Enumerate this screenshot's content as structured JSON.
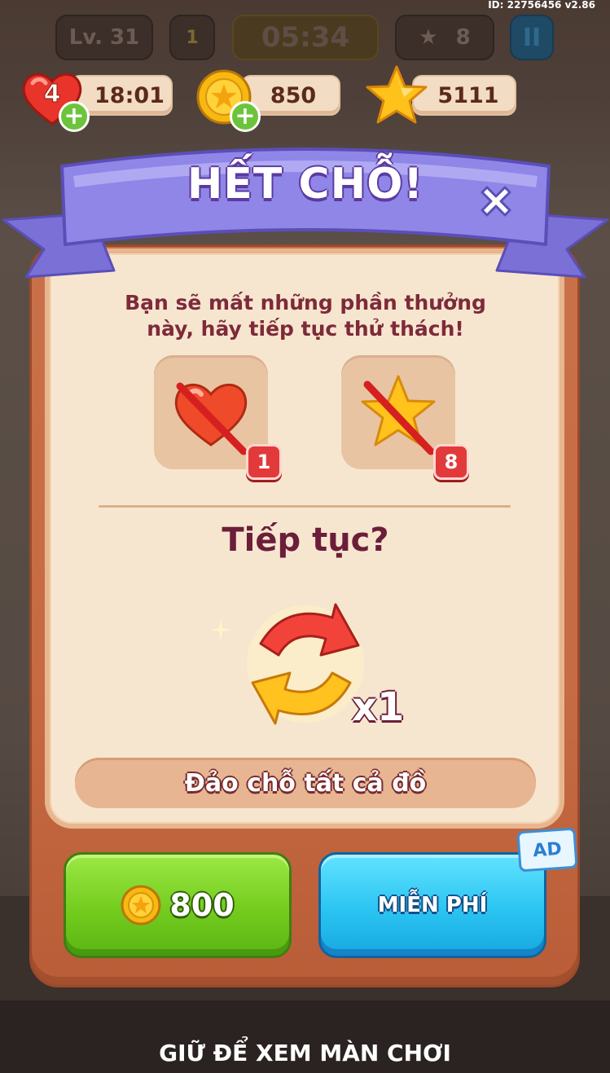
{
  "version_label": "ID: 22756456 v2.86",
  "hud": {
    "level": "Lv. 31",
    "pet_count": "1",
    "timer": "05:34",
    "stars_collected": "8",
    "pause_symbol": "II"
  },
  "resources": {
    "hearts_count": "4",
    "hearts_timer": "18:01",
    "coins": "850",
    "stars": "5111"
  },
  "popup": {
    "title": "HẾT CHỖ!",
    "message": "Bạn sẽ mất những phần thưởng này, hãy tiếp tục thử thách!",
    "rewards": [
      {
        "icon": "heart-icon",
        "count": "1"
      },
      {
        "icon": "star-icon",
        "count": "8"
      }
    ],
    "continue_prompt": "Tiếp tục?",
    "booster_multiplier": "x1",
    "booster_description": "Đảo chỗ tất cả đồ",
    "buy_button_price": "800",
    "free_button_label": "MIỄN PHÍ",
    "ad_badge": "AD"
  },
  "footer": {
    "hold_text": "GIỮ ĐỂ XEM MÀN CHƠI"
  },
  "colors": {
    "ribbon": "#8f86e8",
    "panel_frame": "#c66b43",
    "panel_inner": "#f7e6cf",
    "buy_button": "#74cc1e",
    "free_button": "#2bc4f2",
    "text_accent": "#6b1e3a"
  }
}
